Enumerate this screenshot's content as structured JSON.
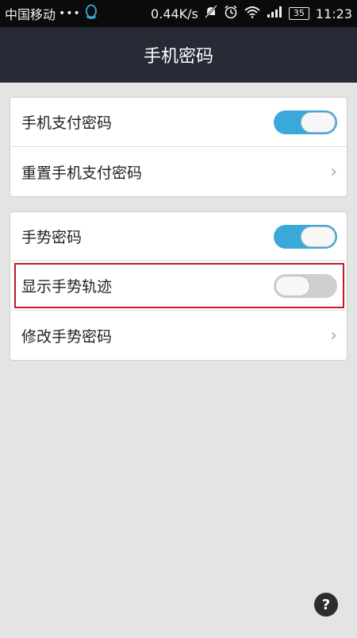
{
  "status_bar": {
    "carrier": "中国移动",
    "dots": "•••",
    "speed": "0.44K/s",
    "battery": "35",
    "time": "11:23",
    "icons": [
      "qq-icon",
      "mute-icon",
      "alarm-icon",
      "wifi-icon",
      "signal-icon",
      "battery-icon"
    ]
  },
  "header": {
    "title": "手机密码"
  },
  "groups": [
    {
      "items": [
        {
          "label": "手机支付密码",
          "control": "toggle",
          "on": true
        },
        {
          "label": "重置手机支付密码",
          "control": "chevron",
          "chevron": "›"
        }
      ]
    },
    {
      "items": [
        {
          "label": "手势密码",
          "control": "toggle",
          "on": true
        },
        {
          "label": "显示手势轨迹",
          "control": "toggle",
          "on": false,
          "highlighted": true
        },
        {
          "label": "修改手势密码",
          "control": "chevron",
          "chevron": "›"
        }
      ]
    }
  ],
  "help": {
    "label": "?"
  },
  "colors": {
    "accent": "#3aa9d9",
    "header_bg": "#252a34",
    "highlight": "#c21b24"
  }
}
